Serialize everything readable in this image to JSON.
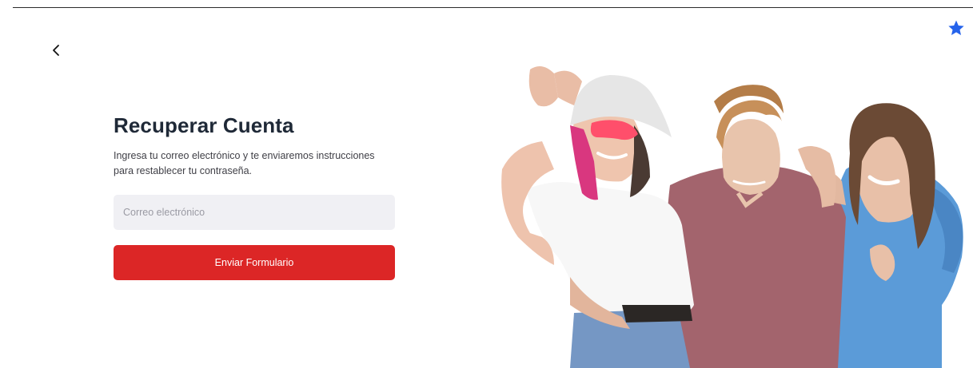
{
  "icons": {
    "back": "chevron-left-icon",
    "favorite": "star-icon"
  },
  "colors": {
    "accent_star": "#2563eb",
    "submit_button": "#dc2626",
    "input_background": "#f0f0f4",
    "title_text": "#1f2937"
  },
  "recovery": {
    "title": "Recuperar Cuenta",
    "description": "Ingresa tu correo electrónico y te enviaremos instrucciones para restablecer tu contraseña.",
    "email": {
      "value": "",
      "placeholder": "Correo electrónico"
    },
    "submit_label": "Enviar Formulario"
  }
}
